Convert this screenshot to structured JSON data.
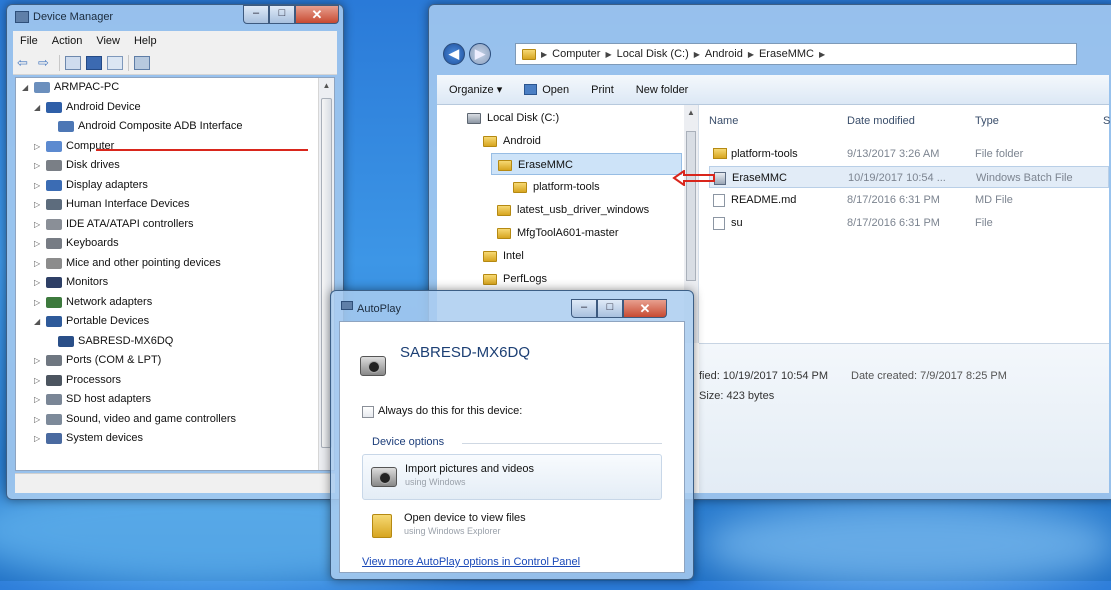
{
  "device_manager": {
    "title": "Device Manager",
    "menu": [
      "File",
      "Action",
      "View",
      "Help"
    ],
    "tree": [
      {
        "label": "ARMPAC-PC",
        "level": 0,
        "expanded": true,
        "icon": "computer-icon"
      },
      {
        "label": "Android Device",
        "level": 1,
        "expanded": true,
        "icon": "phone-icon"
      },
      {
        "label": "Android Composite ADB Interface",
        "level": 2,
        "icon": "phone-icon"
      },
      {
        "label": "Computer",
        "level": 1,
        "icon": "computer-icon"
      },
      {
        "label": "Disk drives",
        "level": 1,
        "icon": "disk-icon"
      },
      {
        "label": "Display adapters",
        "level": 1,
        "icon": "display-icon"
      },
      {
        "label": "Human Interface Devices",
        "level": 1,
        "icon": "hid-icon"
      },
      {
        "label": "IDE ATA/ATAPI controllers",
        "level": 1,
        "icon": "ide-icon"
      },
      {
        "label": "Keyboards",
        "level": 1,
        "icon": "keyboard-icon"
      },
      {
        "label": "Mice and other pointing devices",
        "level": 1,
        "icon": "mouse-icon"
      },
      {
        "label": "Monitors",
        "level": 1,
        "icon": "monitor-icon"
      },
      {
        "label": "Network adapters",
        "level": 1,
        "icon": "network-icon"
      },
      {
        "label": "Portable Devices",
        "level": 1,
        "expanded": true,
        "icon": "portable-icon"
      },
      {
        "label": "SABRESD-MX6DQ",
        "level": 2,
        "icon": "portable-icon"
      },
      {
        "label": "Ports (COM & LPT)",
        "level": 1,
        "icon": "port-icon"
      },
      {
        "label": "Processors",
        "level": 1,
        "icon": "cpu-icon"
      },
      {
        "label": "SD host adapters",
        "level": 1,
        "icon": "sd-icon"
      },
      {
        "label": "Sound, video and game controllers",
        "level": 1,
        "icon": "sound-icon"
      },
      {
        "label": "System devices",
        "level": 1,
        "icon": "system-icon"
      }
    ]
  },
  "explorer": {
    "breadcrumb": [
      "Computer",
      "Local Disk (C:)",
      "Android",
      "EraseMMC"
    ],
    "toolbar": {
      "organize": "Organize ▾",
      "open": "Open",
      "print": "Print",
      "new_folder": "New folder"
    },
    "nav_tree": [
      {
        "label": "Local Disk (C:)",
        "icon": "drive-icon"
      },
      {
        "label": "Android",
        "icon": "folder-icon"
      },
      {
        "label": "EraseMMC",
        "icon": "folder-icon",
        "selected": true
      },
      {
        "label": "platform-tools",
        "icon": "folder-icon"
      },
      {
        "label": "latest_usb_driver_windows",
        "icon": "folder-icon"
      },
      {
        "label": "MfgToolA601-master",
        "icon": "folder-icon"
      },
      {
        "label": "Intel",
        "icon": "folder-icon"
      },
      {
        "label": "PerfLogs",
        "icon": "folder-icon"
      }
    ],
    "columns": {
      "name": "Name",
      "date": "Date modified",
      "type": "Type",
      "size": "S"
    },
    "files": [
      {
        "name": "platform-tools",
        "date": "9/13/2017 3:26 AM",
        "type": "File folder",
        "icon": "folder-icon"
      },
      {
        "name": "EraseMMC",
        "date": "10/19/2017 10:54 ...",
        "type": "Windows Batch File",
        "icon": "batch-file-icon",
        "selected": true
      },
      {
        "name": "README.md",
        "date": "8/17/2016 6:31 PM",
        "type": "MD File",
        "icon": "file-icon"
      },
      {
        "name": "su",
        "date": "8/17/2016 6:31 PM",
        "type": "File",
        "icon": "file-icon"
      }
    ],
    "details": {
      "modified": "fied: 10/19/2017 10:54 PM",
      "created": "Date created: 7/9/2017 8:25 PM",
      "size": "Size: 423 bytes"
    }
  },
  "autoplay": {
    "title": "AutoPlay",
    "device_name": "SABRESD-MX6DQ",
    "always_label": "Always do this for this device:",
    "section_label": "Device options",
    "options": [
      {
        "main": "Import pictures and videos",
        "sub": "using Windows",
        "icon": "camera-icon"
      },
      {
        "main": "Open device to view files",
        "sub": "using Windows Explorer",
        "icon": "folder-icon"
      }
    ],
    "more_link": "View more AutoPlay options in Control Panel"
  },
  "colors": {
    "annotation_red": "#d9261c",
    "link_blue": "#1a49b8",
    "selection": "#cde3f8"
  }
}
